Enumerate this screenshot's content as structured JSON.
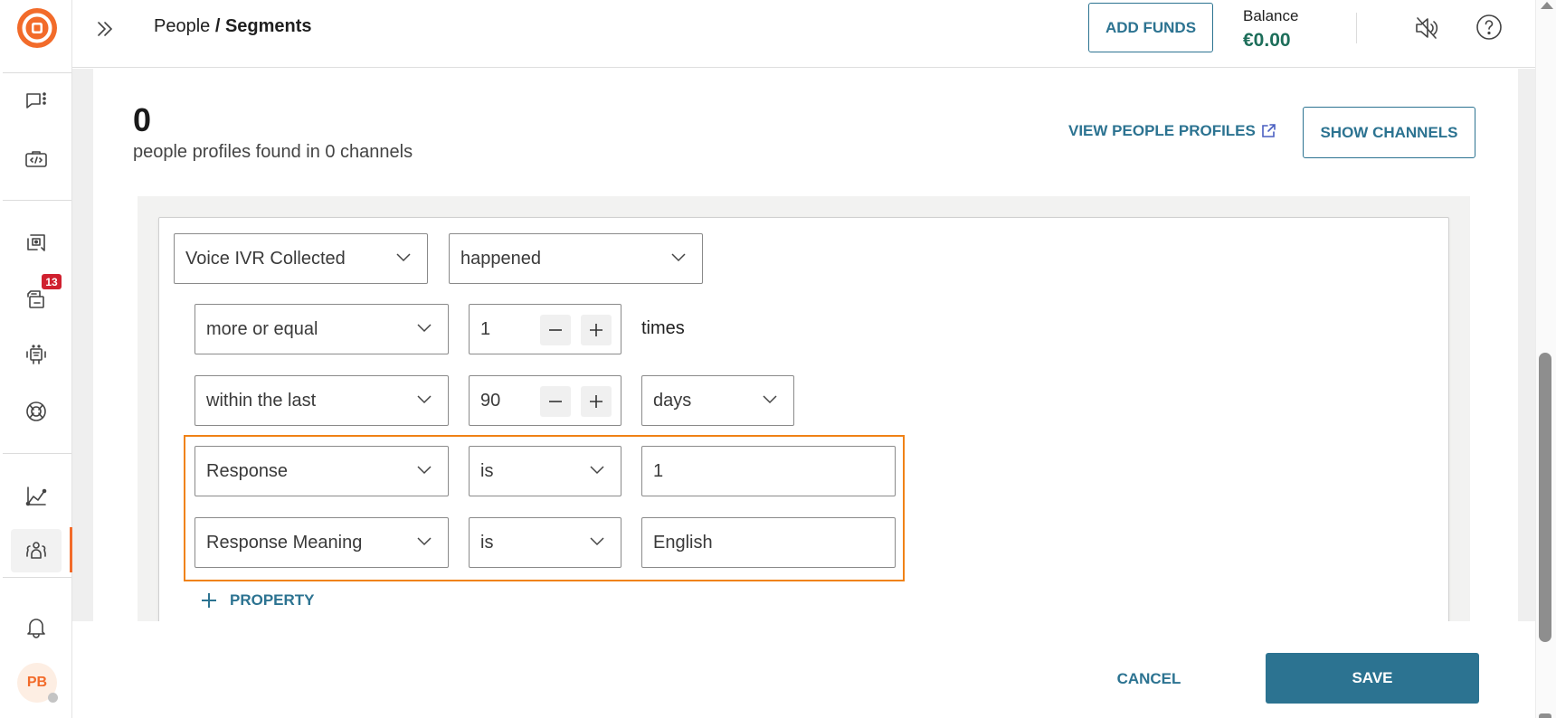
{
  "sidebar": {
    "logo": "brand-logo",
    "items": [
      {
        "name": "conversations",
        "icon": "chat-options-icon"
      },
      {
        "name": "developer",
        "icon": "code-briefcase-icon"
      },
      {
        "name": "inbox",
        "icon": "chat-search-icon"
      },
      {
        "name": "campaigns",
        "icon": "cards-icon",
        "badge": "13"
      },
      {
        "name": "bots",
        "icon": "robot-icon"
      },
      {
        "name": "integrations",
        "icon": "openai-knot-icon"
      },
      {
        "name": "analytics",
        "icon": "line-chart-icon"
      },
      {
        "name": "people",
        "icon": "people-icon",
        "active": true
      },
      {
        "name": "notifications",
        "icon": "bell-icon"
      }
    ],
    "avatar_initials": "PB",
    "accent_color": "#f26b2a"
  },
  "header": {
    "breadcrumb_parent": "People",
    "breadcrumb_separator": " / ",
    "breadcrumb_current": "Segments",
    "add_funds_label": "ADD FUNDS",
    "balance_label": "Balance",
    "balance_value": "€0.00"
  },
  "summary": {
    "count": "0",
    "description": "people profiles found in 0 channels",
    "view_profiles_label": "VIEW PEOPLE PROFILES",
    "show_channels_label": "SHOW CHANNELS"
  },
  "filter": {
    "event": "Voice IVR Collected",
    "event_condition": "happened",
    "frequency_operator": "more or equal",
    "frequency_value": "1",
    "frequency_unit": "times",
    "time_operator": "within the last",
    "time_value": "90",
    "time_unit": "days",
    "properties": [
      {
        "property": "Response",
        "operator": "is",
        "value": "1"
      },
      {
        "property": "Response Meaning",
        "operator": "is",
        "value": "English"
      }
    ],
    "add_property_label": "PROPERTY"
  },
  "footer": {
    "cancel_label": "CANCEL",
    "save_label": "SAVE"
  },
  "colors": {
    "primary": "#2c7391",
    "brand": "#f26b2a",
    "highlight": "#f08216",
    "balance": "#1d6e5a",
    "badge": "#d0202f"
  }
}
